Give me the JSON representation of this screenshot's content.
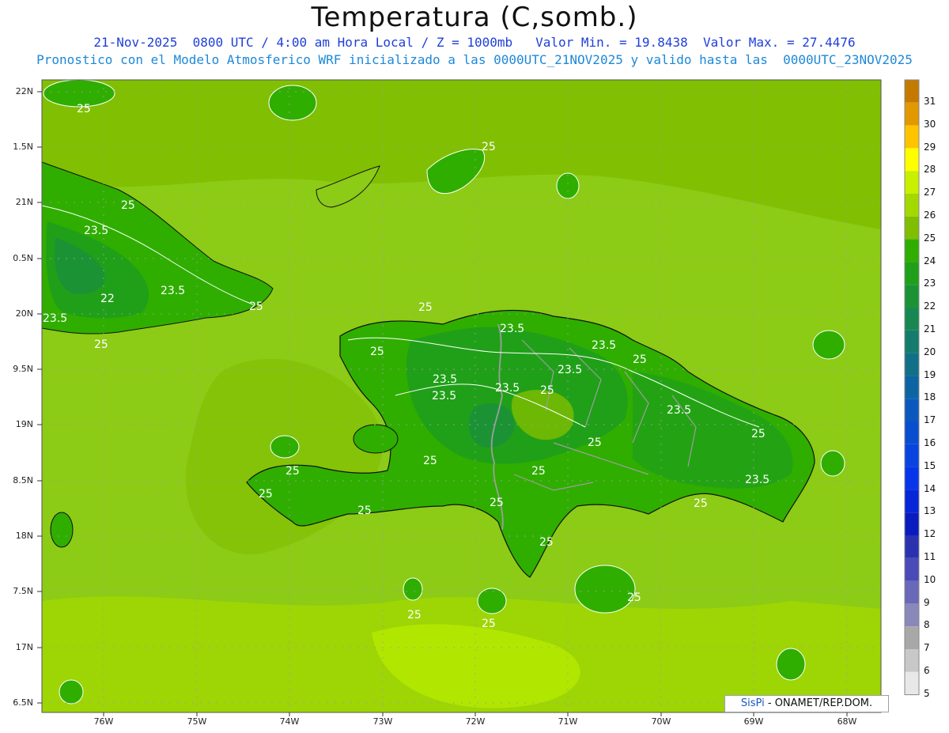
{
  "header": {
    "title": "Temperatura (C,somb.)",
    "line1": "21-Nov-2025  0800 UTC / 4:00 am Hora Local / Z = 1000mb   Valor Min. = 19.8438  Valor Max. = 27.4476",
    "line2": "Pronostico con el Modelo Atmosferico WRF inicializado a las 0000UTC_21NOV2025 y valido hasta las  0000UTC_23NOV2025"
  },
  "credit": {
    "brand": "SisPi",
    "text": " - ONAMET/REP.DOM."
  },
  "axes": {
    "lat_labels": [
      "22N",
      "1.5N",
      "21N",
      "0.5N",
      "20N",
      "9.5N",
      "19N",
      "8.5N",
      "18N",
      "7.5N",
      "17N",
      "6.5N"
    ],
    "lon_labels": [
      "76W",
      "75W",
      "74W",
      "73W",
      "72W",
      "71W",
      "70W",
      "69W",
      "68W"
    ]
  },
  "contour_labels": [
    "25",
    "25",
    "25",
    "23.5",
    "23.5",
    "22",
    "25",
    "25",
    "23.5",
    "25",
    "25",
    "23.5",
    "23.5",
    "23.5",
    "23.5",
    "23.5",
    "25",
    "25",
    "23.5",
    "25",
    "25",
    "25",
    "25",
    "25",
    "23.5",
    "25",
    "25",
    "25",
    "25",
    "25",
    "25",
    "25",
    "25"
  ],
  "colorbar": {
    "labels": [
      "31",
      "30",
      "29",
      "28",
      "27",
      "26",
      "25",
      "24",
      "23",
      "22",
      "21",
      "20",
      "19",
      "18",
      "17",
      "16",
      "15",
      "14",
      "13",
      "12",
      "11",
      "10",
      "9",
      "8",
      "7",
      "6",
      "5"
    ],
    "colors": [
      "#c47a00",
      "#e29800",
      "#ffc400",
      "#ffff00",
      "#c8f000",
      "#a3d800",
      "#7fbe00",
      "#2fae00",
      "#20a018",
      "#1b9334",
      "#178852",
      "#137c6d",
      "#107088",
      "#0d64a3",
      "#0a58bd",
      "#0a4ed0",
      "#0944e0",
      "#0835ea",
      "#0726d8",
      "#0a1cbf",
      "#2a32b0",
      "#4a4ab8",
      "#6a68b8",
      "#8a88b8",
      "#a8a8a8",
      "#c8c8c8",
      "#e8e8e8"
    ]
  }
}
